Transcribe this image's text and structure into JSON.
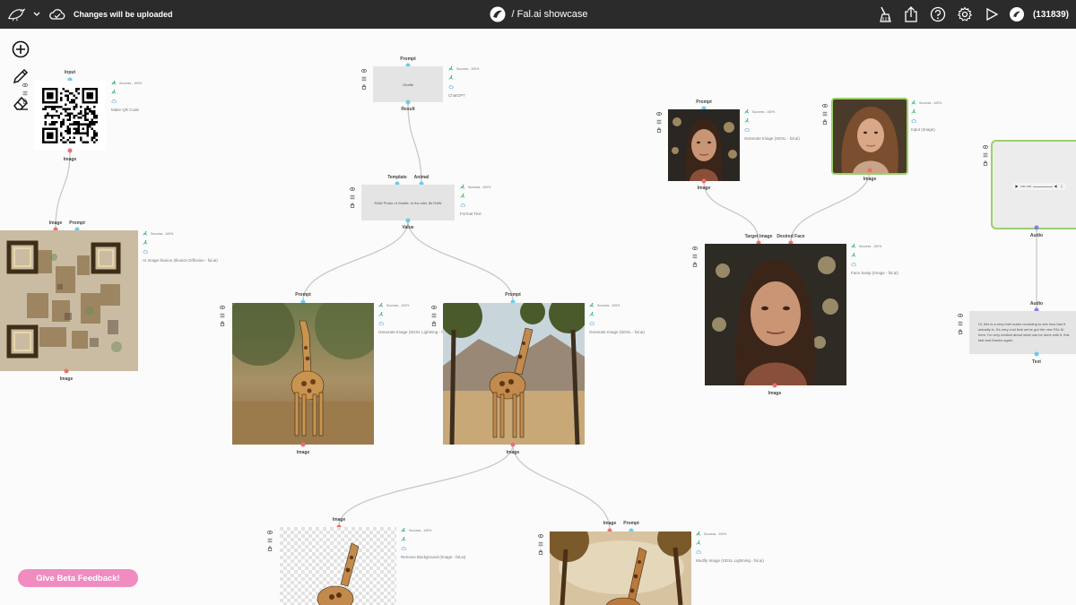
{
  "topbar": {
    "upload_status": "Changes will be uploaded",
    "project_title": "/ Fal.ai showcase",
    "user_id": "(131839)",
    "icons": [
      "logo-bird-icon",
      "chevron-down-icon",
      "cloud-check-icon",
      "broom-icon",
      "share-icon",
      "help-icon",
      "gear-icon",
      "play-icon",
      "fal-logo-icon"
    ]
  },
  "tools": [
    "plus-circle-icon",
    "pencil-icon",
    "eraser-icon"
  ],
  "feedback_button": "Give Beta Feedback!",
  "status_text": "Success - 100%",
  "nodes": {
    "qr": {
      "in": "Input",
      "out": "Image",
      "label": "Make QR Code"
    },
    "illusion": {
      "in1": "Image",
      "in2": "Prompt",
      "out": "Image",
      "label": "AI Image Illusion (Illusion Diffusion - fal.ai)"
    },
    "chatgpt": {
      "in": "Prompt",
      "out": "Result",
      "text": "Giraffe",
      "label": "ChatGPT"
    },
    "format": {
      "in1": "Template",
      "in2": "Animal",
      "out": "Value",
      "text": "RAW Photo of Giraffe, in the wild, 8k RAW",
      "label": "Format Text"
    },
    "gen1": {
      "in": "Prompt",
      "out": "Image",
      "label": "Generate Image (SDXL Lightning - fal.ai)"
    },
    "gen2": {
      "in": "Prompt",
      "out": "Image",
      "label": "Generate Image (SDXL - fal.ai)"
    },
    "removebg": {
      "in": "Image",
      "label": "Remove Background (Image - fal.ai)"
    },
    "modify": {
      "in1": "Image",
      "in2": "Prompt",
      "label": "Modify Image (SDXL Lightning - fal.ai)"
    },
    "genface": {
      "in": "Prompt",
      "out": "Image",
      "label": "Generate Image (SDXL - fal.ai)"
    },
    "inputimg": {
      "out": "Image",
      "label": "Input (Image)"
    },
    "faceswap": {
      "in1": "Target Image",
      "in2": "Desired Face",
      "out": "Image",
      "label": "Face Swap (Image - fal.ai)"
    },
    "audio": {
      "out": "Audio",
      "player": "0:00 / 0:09"
    },
    "transcribe": {
      "in": "Audio",
      "out": "Text",
      "text": "Hi, this is a very brief audio recording to see how fast it actually is. It's very cool that we've got the new FAL AI here. I'm very excited about what can be done with it. this fast and thanks again."
    }
  },
  "colors": {
    "topbar": "#2b2b2b",
    "port_in": "#6ccbe9",
    "port_out": "#ee6e6e",
    "selected_border": "#9ad16b",
    "feedback": "#f08cbf",
    "success_icon": "#1a9e6a"
  }
}
